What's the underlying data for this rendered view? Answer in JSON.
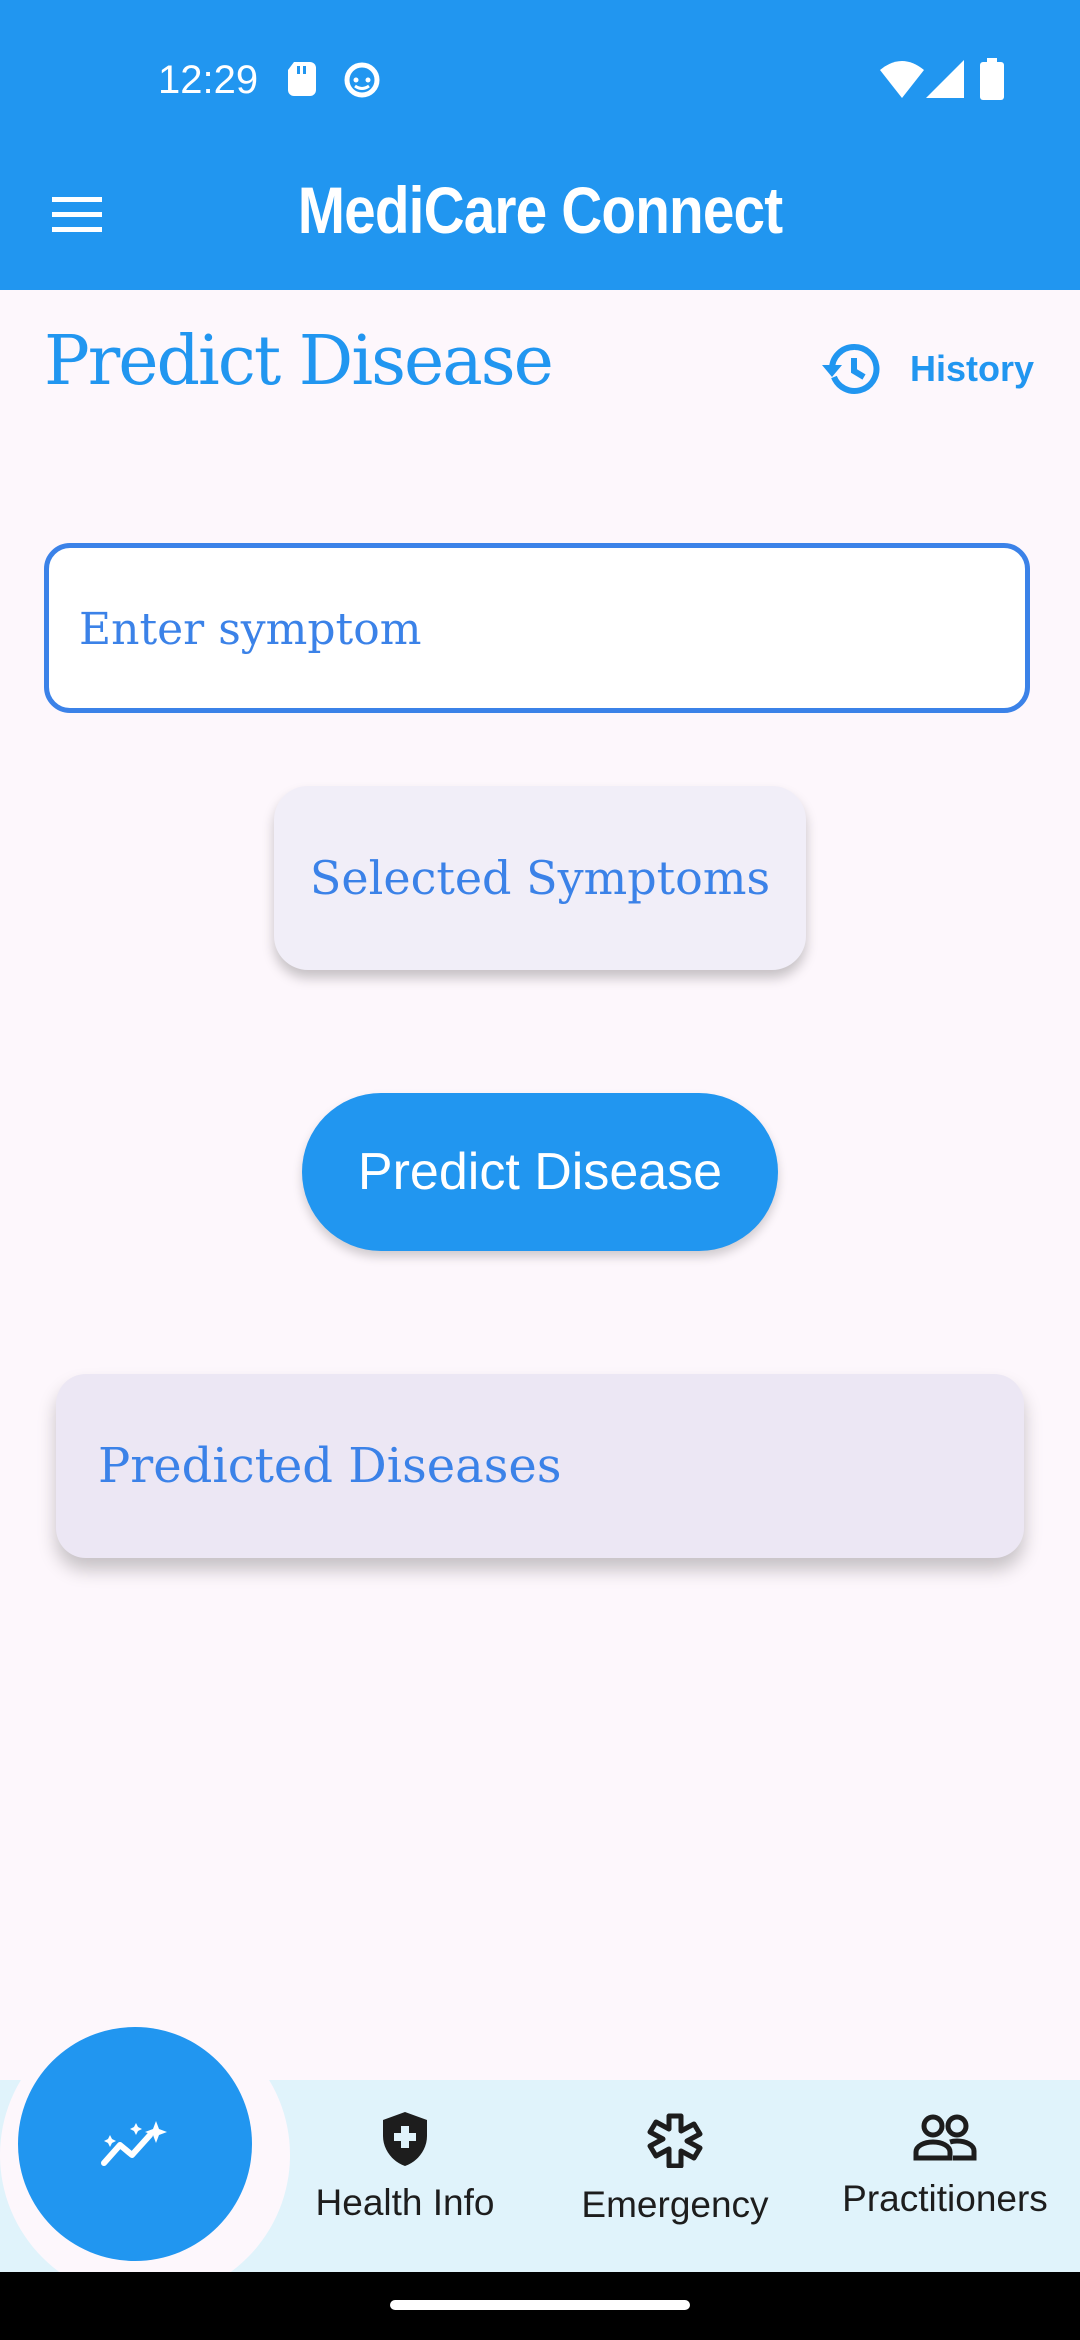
{
  "status_bar": {
    "time": "12:29",
    "icons": [
      "sd-card-icon",
      "notification-face-icon",
      "wifi-icon",
      "signal-icon",
      "battery-icon"
    ]
  },
  "app_bar": {
    "title": "MediCare Connect",
    "menu_icon": "menu-icon"
  },
  "page": {
    "title": "Predict Disease",
    "history_label": "History"
  },
  "symptom_input": {
    "placeholder": "Enter symptom",
    "value": ""
  },
  "selected_symptoms": {
    "label": "Selected Symptoms"
  },
  "predict_button": {
    "label": "Predict Disease"
  },
  "predicted_diseases": {
    "label": "Predicted Diseases"
  },
  "bottom_nav": {
    "fab_icon": "predict-sparkle-icon",
    "items": [
      {
        "label": "Health Info",
        "icon": "shield-plus-icon"
      },
      {
        "label": "Emergency",
        "icon": "medical-star-icon"
      },
      {
        "label": "Practitioners",
        "icon": "people-icon"
      }
    ]
  },
  "colors": {
    "primary": "#2196f0",
    "accent_text": "#3b82e8",
    "background": "#fdf7fc",
    "nav_background": "#e0f3fb"
  }
}
